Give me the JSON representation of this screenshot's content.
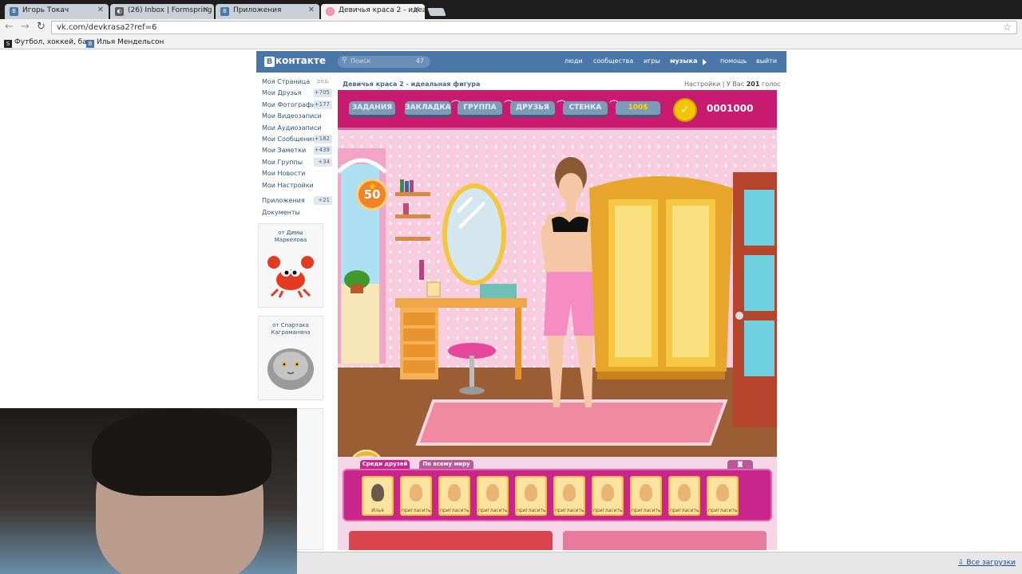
{
  "browser": {
    "tabs": [
      {
        "label": "Игорь Токач",
        "active": false
      },
      {
        "label": "(26) Inbox | Formspring",
        "active": false
      },
      {
        "label": "Приложения",
        "active": false
      },
      {
        "label": "Девичья краса 2 - идеал",
        "active": true
      }
    ],
    "url": "vk.com/devkrasa2?ref=6",
    "bookmarks": [
      "Футбол, хоккей, ба...",
      "Илья Мендельсон"
    ],
    "download_link": "Все загрузки"
  },
  "vk": {
    "logo": "контакте",
    "logo_letter": "В",
    "search_placeholder": "Поиск",
    "search_count": "47",
    "topnav": [
      "люди",
      "сообщества",
      "игры",
      "музыка",
      "помощь",
      "выйти"
    ],
    "menu": [
      {
        "label": "Моя Страница",
        "count": ""
      },
      {
        "label": "Мои Друзья",
        "count": "+705"
      },
      {
        "label": "Мои Фотографии",
        "count": "+177"
      },
      {
        "label": "Мои Видеозаписи",
        "count": ""
      },
      {
        "label": "Мои Аудиозаписи",
        "count": ""
      },
      {
        "label": "Мои Сообщения",
        "count": "+182"
      },
      {
        "label": "Мои Заметки",
        "count": "+439"
      },
      {
        "label": "Мои Группы",
        "count": "+34"
      },
      {
        "label": "Мои Новости",
        "count": ""
      },
      {
        "label": "Мои Настройки",
        "count": ""
      },
      {
        "label": "Приложения",
        "count": "+21"
      },
      {
        "label": "Документы",
        "count": ""
      }
    ],
    "edit_label": "ред.",
    "gifts": [
      "от Димы Маркелова",
      "от Спартака Каграманяна"
    ]
  },
  "app": {
    "title": "Девичья краса 2 - идеальная фигура",
    "settings_label": "Настройки",
    "votes_prefix": "У Вас",
    "votes_count": "201",
    "votes_suffix": "голос"
  },
  "game": {
    "toolbar_buttons": [
      "ЗАДАНИЯ",
      "ЗАКЛАДКА",
      "ГРУППА",
      "ДРУЗЬЯ",
      "СТЕНКА",
      "100$"
    ],
    "coins": "0001000",
    "level": "50",
    "tabs": [
      "Среди друзей",
      "По всему миру"
    ],
    "friend_name": "Илья",
    "invite_label": "пригласить",
    "invite_slots": 9,
    "colors": {
      "toolbar": "#c81a6e",
      "wall": "#f8cde0",
      "accent": "#c8268c"
    }
  }
}
